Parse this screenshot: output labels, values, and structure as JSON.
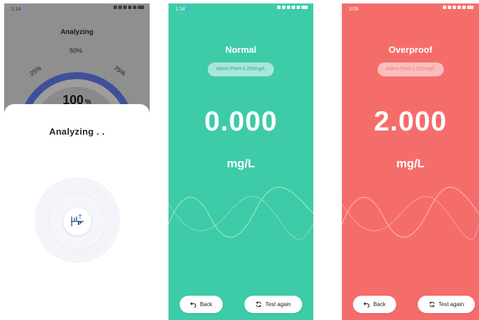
{
  "screens": {
    "analyzing": {
      "status_time": "1:14",
      "title": "Analyzing",
      "gauge_labels": [
        "25%",
        "50%",
        "75%"
      ],
      "gauge_value": "100",
      "gauge_unit": "%",
      "progress": 1.0,
      "sheet_title": "Analyzing . .",
      "icon": "analysis-chart-icon"
    },
    "normal": {
      "status_time": "1:14",
      "title": "Normal",
      "alarm_point": "Alarm Point 0.250mg/L",
      "value": "0.000",
      "unit": "mg/L",
      "back_label": "Back",
      "test_again_label": "Test again",
      "color": "#3ecba8"
    },
    "overproof": {
      "status_time": "3:09",
      "title": "Overproof",
      "alarm_point": "Alarm Point 0.250mg/L",
      "value": "2.000",
      "unit": "mg/L",
      "back_label": "Back",
      "test_again_label": "Test again",
      "color": "#f56d6a"
    }
  }
}
